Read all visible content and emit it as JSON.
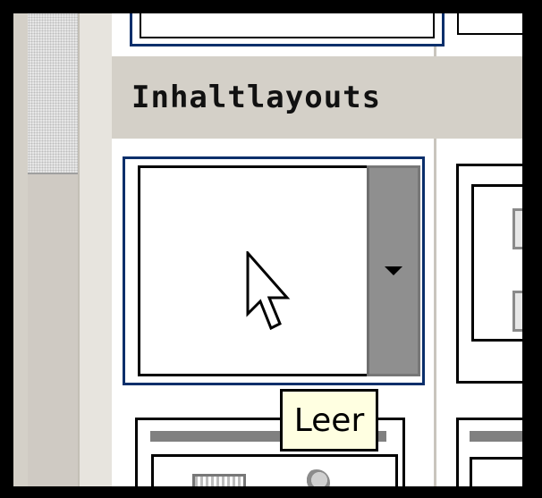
{
  "panel": {
    "section_heading": "Inhaltlayouts"
  },
  "layouts": [
    {
      "name": "Leer",
      "selected": true,
      "has_dropdown": true
    }
  ],
  "tooltip": {
    "text": "Leer"
  },
  "icons": {
    "dropdown": "triangle-down",
    "cursor": "pointer-arrow"
  },
  "colors": {
    "selection_border": "#0b2f6b",
    "tooltip_bg": "#ffffe1",
    "panel_bg": "#d4d0c8"
  }
}
